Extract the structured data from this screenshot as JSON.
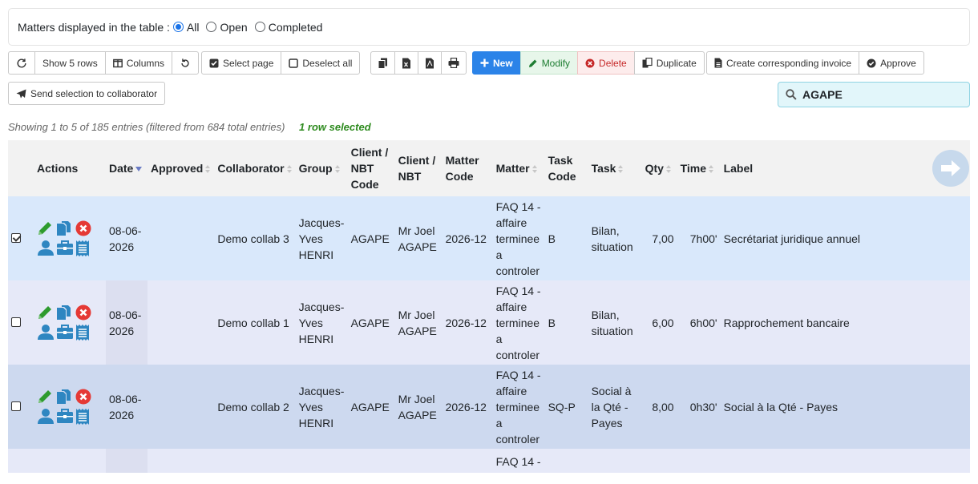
{
  "filter": {
    "label": "Matters displayed in the table :",
    "options": [
      "All",
      "Open",
      "Completed"
    ],
    "selected": "All"
  },
  "toolbar": {
    "show_rows": "Show 5 rows",
    "columns": "Columns",
    "select_page": "Select page",
    "deselect_all": "Deselect all",
    "new": "New",
    "modify": "Modify",
    "delete": "Delete",
    "duplicate": "Duplicate",
    "create_invoice": "Create corresponding invoice",
    "approve": "Approve",
    "send_selection": "Send selection to collaborator"
  },
  "search": {
    "value": "AGAPE"
  },
  "info": {
    "entries": "Showing 1 to 5 of 185 entries (filtered from 684 total entries)",
    "selected": "1 row selected"
  },
  "columns": {
    "actions": "Actions",
    "date": "Date",
    "approved": "Approved",
    "collaborator": "Collaborator",
    "group": "Group",
    "client_code": "Client / NBT Code",
    "client": "Client / NBT",
    "matter_code": "Matter Code",
    "matter": "Matter",
    "task_code": "Task Code",
    "task": "Task",
    "qty": "Qty",
    "time": "Time",
    "label": "Label"
  },
  "rows": [
    {
      "selected": true,
      "date": "08-06-2026",
      "approved": "",
      "collaborator": "Demo collab 3",
      "group": "Jacques-Yves HENRI",
      "client_code": "AGAPE",
      "client": "Mr Joel AGAPE",
      "matter_code": "2026-12",
      "matter": "FAQ 14 - affaire terminee a controler",
      "task_code": "B",
      "task": "Bilan, situation",
      "qty": "7,00",
      "time": "7h00'",
      "label": "Secrétariat juridique annuel"
    },
    {
      "selected": false,
      "date": "08-06-2026",
      "approved": "",
      "collaborator": "Demo collab 1",
      "group": "Jacques-Yves HENRI",
      "client_code": "AGAPE",
      "client": "Mr Joel AGAPE",
      "matter_code": "2026-12",
      "matter": "FAQ 14 - affaire terminee a controler",
      "task_code": "B",
      "task": "Bilan, situation",
      "qty": "6,00",
      "time": "6h00'",
      "label": "Rapprochement bancaire"
    },
    {
      "selected": false,
      "date": "08-06-2026",
      "approved": "",
      "collaborator": "Demo collab 2",
      "group": "Jacques-Yves HENRI",
      "client_code": "AGAPE",
      "client": "Mr Joel AGAPE",
      "matter_code": "2026-12",
      "matter": "FAQ 14 - affaire terminee a controler",
      "task_code": "SQ-P",
      "task": "Social à la Qté - Payes",
      "qty": "8,00",
      "time": "0h30'",
      "label": "Social à la Qté - Payes"
    },
    {
      "selected": false,
      "date": "",
      "approved": "",
      "collaborator": "",
      "group": "",
      "client_code": "",
      "client": "",
      "matter_code": "",
      "matter": "FAQ 14 -",
      "task_code": "",
      "task": "",
      "qty": "",
      "time": "",
      "label": ""
    }
  ],
  "colors": {
    "primary": "#2b83e8",
    "action_icon": "#2e86c1",
    "edit_icon": "#2e9b2e",
    "delete_icon": "#e53935",
    "selected_text": "#2e8b1f"
  }
}
